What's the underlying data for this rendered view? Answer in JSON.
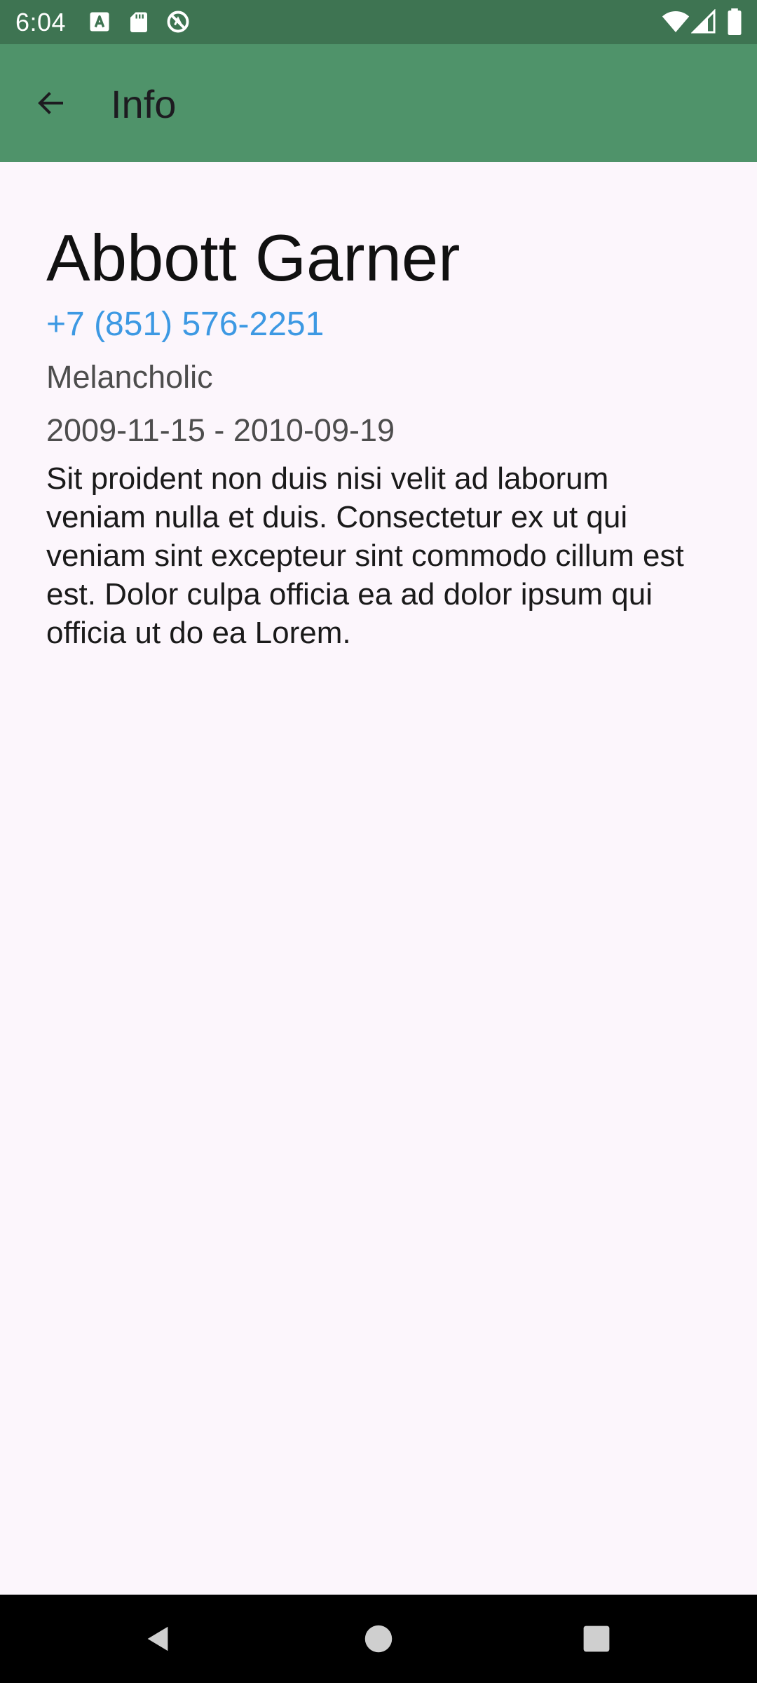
{
  "status_bar": {
    "time": "6:04",
    "left_icons": [
      "keyboard-a-icon",
      "sd-card-icon",
      "do-not-disturb-icon"
    ],
    "right_icons": [
      "wifi-icon",
      "cell-signal-icon",
      "battery-icon"
    ]
  },
  "app_bar": {
    "title": "Info",
    "back_icon": "arrow-back-icon",
    "color": "#4f936a"
  },
  "contact": {
    "name": "Abbott Garner",
    "phone": "+7 (851) 576-2251",
    "temperament": "Melancholic",
    "period": "2009-11-15 - 2010-09-19",
    "description": "Sit proident non duis nisi velit ad laborum veniam nulla et duis. Consectetur ex ut qui veniam sint excepteur sint commodo cillum est est. Dolor culpa officia ea ad dolor ipsum qui officia ut do ea Lorem."
  },
  "colors": {
    "status_bar": "#3e7452",
    "app_bar": "#4f936a",
    "background": "#fcf6fc",
    "link": "#3d99e3"
  },
  "nav_bar": {
    "buttons": [
      "back-triangle-icon",
      "home-circle-icon",
      "recents-square-icon"
    ]
  }
}
